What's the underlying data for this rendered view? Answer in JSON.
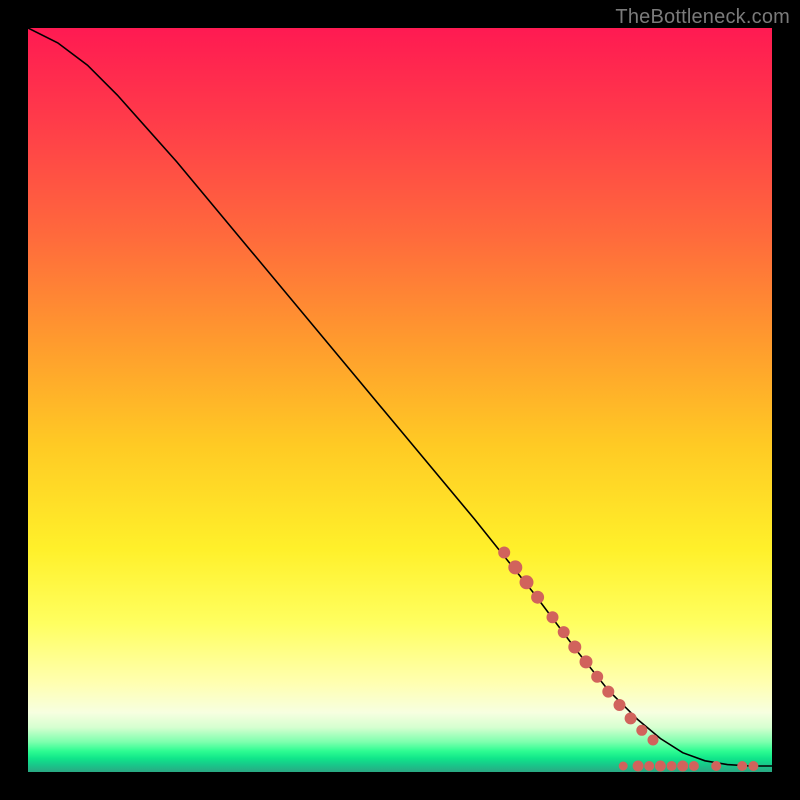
{
  "attribution": "TheBottleneck.com",
  "chart_data": {
    "type": "line",
    "title": "",
    "xlabel": "",
    "ylabel": "",
    "xlim": [
      0,
      100
    ],
    "ylim": [
      0,
      100
    ],
    "background_gradient": {
      "orientation": "vertical",
      "stops": [
        {
          "pos": 0.0,
          "color": "#ff1a52"
        },
        {
          "pos": 0.28,
          "color": "#ff6a3c"
        },
        {
          "pos": 0.56,
          "color": "#ffca24"
        },
        {
          "pos": 0.8,
          "color": "#ffff60"
        },
        {
          "pos": 0.92,
          "color": "#f7ffe0"
        },
        {
          "pos": 0.97,
          "color": "#2dfc92"
        },
        {
          "pos": 1.0,
          "color": "#2aa883"
        }
      ]
    },
    "series": [
      {
        "name": "curve",
        "style": "line",
        "color": "#000000",
        "x": [
          0,
          4,
          8,
          12,
          20,
          30,
          40,
          50,
          60,
          68,
          74,
          78,
          82,
          85,
          88,
          91,
          94,
          97,
          100
        ],
        "y": [
          100,
          98,
          95,
          91,
          82,
          70,
          58,
          46,
          34,
          24,
          16,
          11,
          7,
          4.5,
          2.6,
          1.5,
          1.0,
          0.8,
          0.8
        ]
      },
      {
        "name": "markers",
        "style": "scatter",
        "color": "#d1635c",
        "points": [
          {
            "x": 64.0,
            "y": 29.5,
            "r": 5.5
          },
          {
            "x": 65.5,
            "y": 27.5,
            "r": 6.5
          },
          {
            "x": 67.0,
            "y": 25.5,
            "r": 6.5
          },
          {
            "x": 68.5,
            "y": 23.5,
            "r": 6.0
          },
          {
            "x": 70.5,
            "y": 20.8,
            "r": 5.5
          },
          {
            "x": 72.0,
            "y": 18.8,
            "r": 5.5
          },
          {
            "x": 73.5,
            "y": 16.8,
            "r": 6.0
          },
          {
            "x": 75.0,
            "y": 14.8,
            "r": 6.0
          },
          {
            "x": 76.5,
            "y": 12.8,
            "r": 5.5
          },
          {
            "x": 78.0,
            "y": 10.8,
            "r": 5.5
          },
          {
            "x": 79.5,
            "y": 9.0,
            "r": 5.5
          },
          {
            "x": 81.0,
            "y": 7.2,
            "r": 5.5
          },
          {
            "x": 82.5,
            "y": 5.6,
            "r": 5.0
          },
          {
            "x": 84.0,
            "y": 4.3,
            "r": 5.0
          },
          {
            "x": 80.0,
            "y": 0.8,
            "r": 4.0
          },
          {
            "x": 82.0,
            "y": 0.8,
            "r": 5.0
          },
          {
            "x": 83.5,
            "y": 0.8,
            "r": 4.5
          },
          {
            "x": 85.0,
            "y": 0.8,
            "r": 5.0
          },
          {
            "x": 86.5,
            "y": 0.8,
            "r": 4.5
          },
          {
            "x": 88.0,
            "y": 0.8,
            "r": 5.0
          },
          {
            "x": 89.5,
            "y": 0.8,
            "r": 4.5
          },
          {
            "x": 92.5,
            "y": 0.8,
            "r": 4.5
          },
          {
            "x": 96.0,
            "y": 0.8,
            "r": 4.5
          },
          {
            "x": 97.5,
            "y": 0.8,
            "r": 4.5
          }
        ]
      }
    ]
  }
}
